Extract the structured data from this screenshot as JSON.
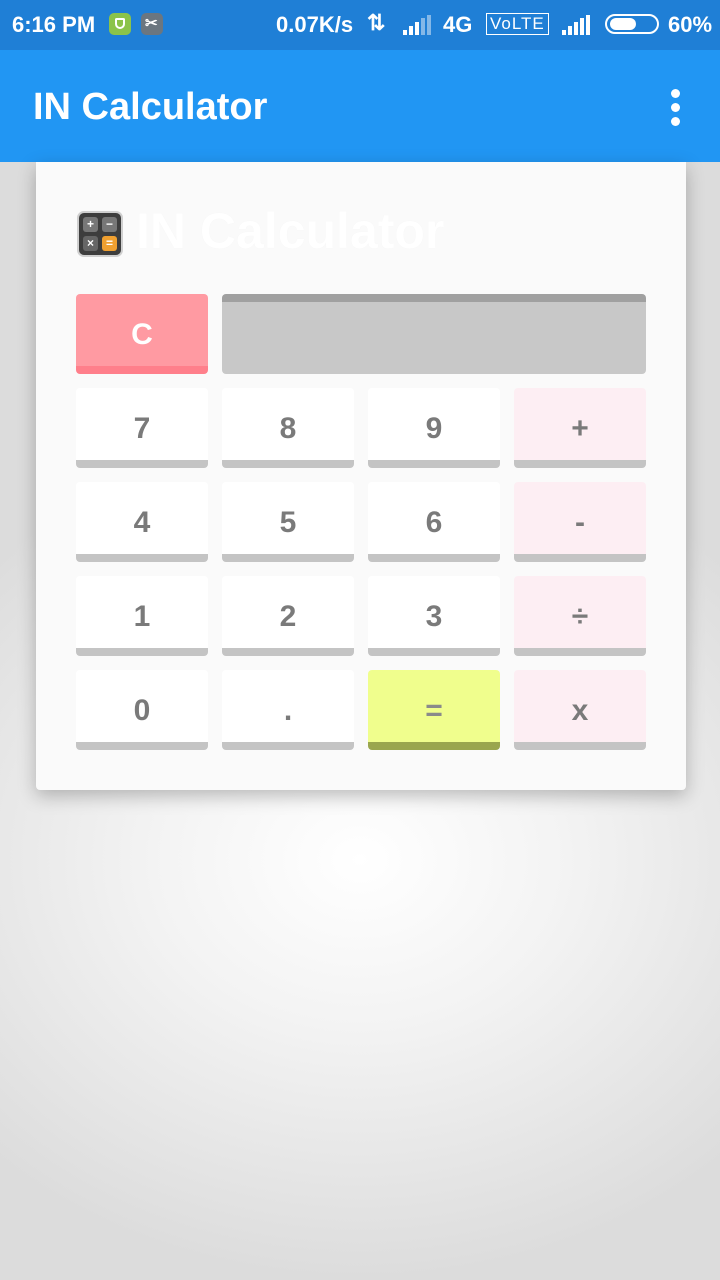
{
  "status_bar": {
    "time": "6:16 PM",
    "net_speed": "0.07K/s",
    "data_arrows": "⇅",
    "network_type": "4G",
    "volte": "VoLTE",
    "battery_percent": "60%",
    "battery_level": 0.6,
    "icons": [
      "shield-icon",
      "scissors-icon",
      "data-activity-icon",
      "signal-icon",
      "signal-icon",
      "battery-icon"
    ]
  },
  "app_bar": {
    "title": "IN Calculator",
    "menu_icon": "overflow-menu-icon"
  },
  "card": {
    "title": "IN Calculator",
    "icon": "calculator-icon",
    "calc_icon_glyphs": [
      "+",
      "−",
      "×",
      "="
    ]
  },
  "calculator": {
    "display_value": "",
    "clear_label": "C",
    "keys": [
      [
        "7",
        "8",
        "9",
        "+"
      ],
      [
        "4",
        "5",
        "6",
        "-"
      ],
      [
        "1",
        "2",
        "3",
        "÷"
      ],
      [
        "0",
        ".",
        "=",
        "x"
      ]
    ]
  },
  "colors": {
    "status_bar": "#1f7fd6",
    "app_bar": "#2196f3",
    "clear_key": "#ff9aa2",
    "equals_key": "#f0fe8d",
    "operator_key": "#fdeef3",
    "display": "#c8c8c8"
  }
}
